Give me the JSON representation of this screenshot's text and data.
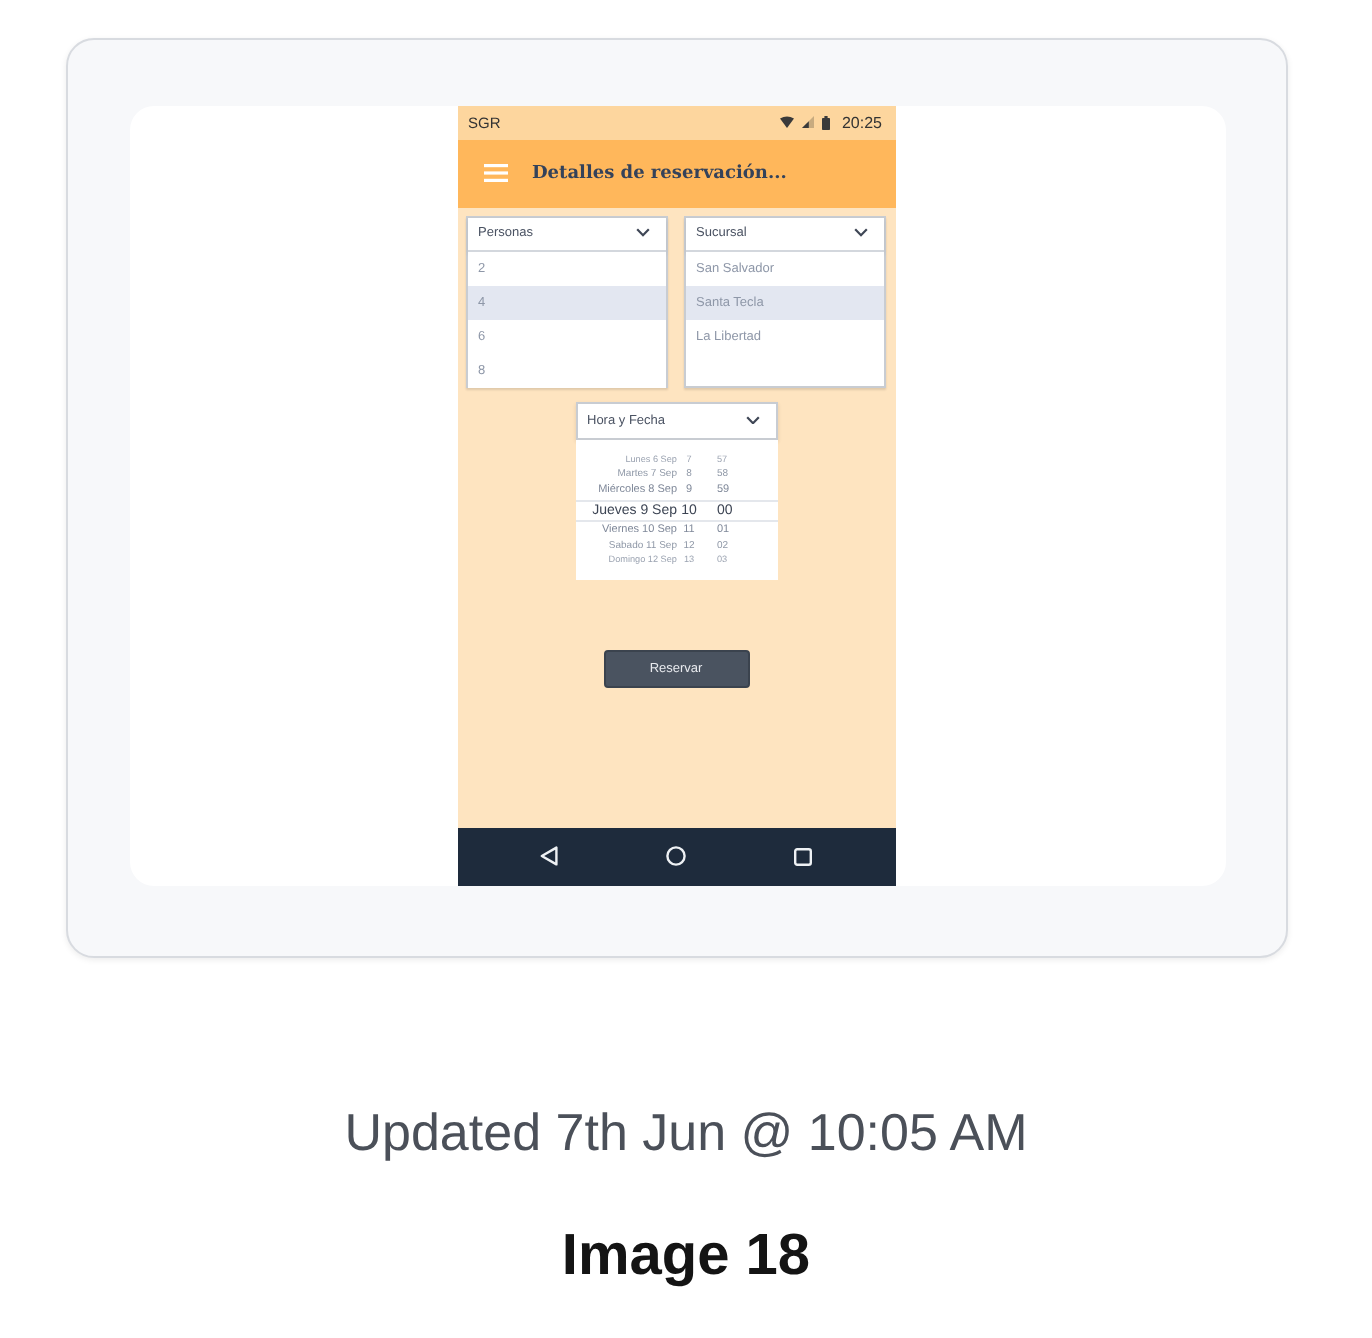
{
  "status_bar": {
    "carrier": "SGR",
    "time": "20:25"
  },
  "app_bar": {
    "title": "Detalles de reservación..."
  },
  "dropdowns": [
    {
      "label": "Personas",
      "options": [
        {
          "label": "2",
          "selected": false
        },
        {
          "label": "4",
          "selected": true
        },
        {
          "label": "6",
          "selected": false
        },
        {
          "label": "8",
          "selected": false
        }
      ]
    },
    {
      "label": "Sucursal",
      "options": [
        {
          "label": "San Salvador",
          "selected": false
        },
        {
          "label": "Santa Tecla",
          "selected": true
        },
        {
          "label": "La Libertad",
          "selected": false
        }
      ]
    }
  ],
  "datetime_picker": {
    "label": "Hora y Fecha",
    "rows": [
      {
        "day": "Lunes 6 Sep",
        "hour": "7",
        "minute": "57",
        "selected": false
      },
      {
        "day": "Martes 7 Sep",
        "hour": "8",
        "minute": "58",
        "selected": false
      },
      {
        "day": "Miércoles 8 Sep",
        "hour": "9",
        "minute": "59",
        "selected": false
      },
      {
        "day": "Jueves 9 Sep",
        "hour": "10",
        "minute": "00",
        "selected": true
      },
      {
        "day": "Viernes 10 Sep",
        "hour": "11",
        "minute": "01",
        "selected": false
      },
      {
        "day": "Sabado 11 Sep",
        "hour": "12",
        "minute": "02",
        "selected": false
      },
      {
        "day": "Domingo 12 Sep",
        "hour": "13",
        "minute": "03",
        "selected": false
      }
    ]
  },
  "reserve_button": {
    "label": "Reservar"
  },
  "caption": {
    "updated": "Updated 7th Jun @ 10:05 AM",
    "title": "Image 18"
  }
}
